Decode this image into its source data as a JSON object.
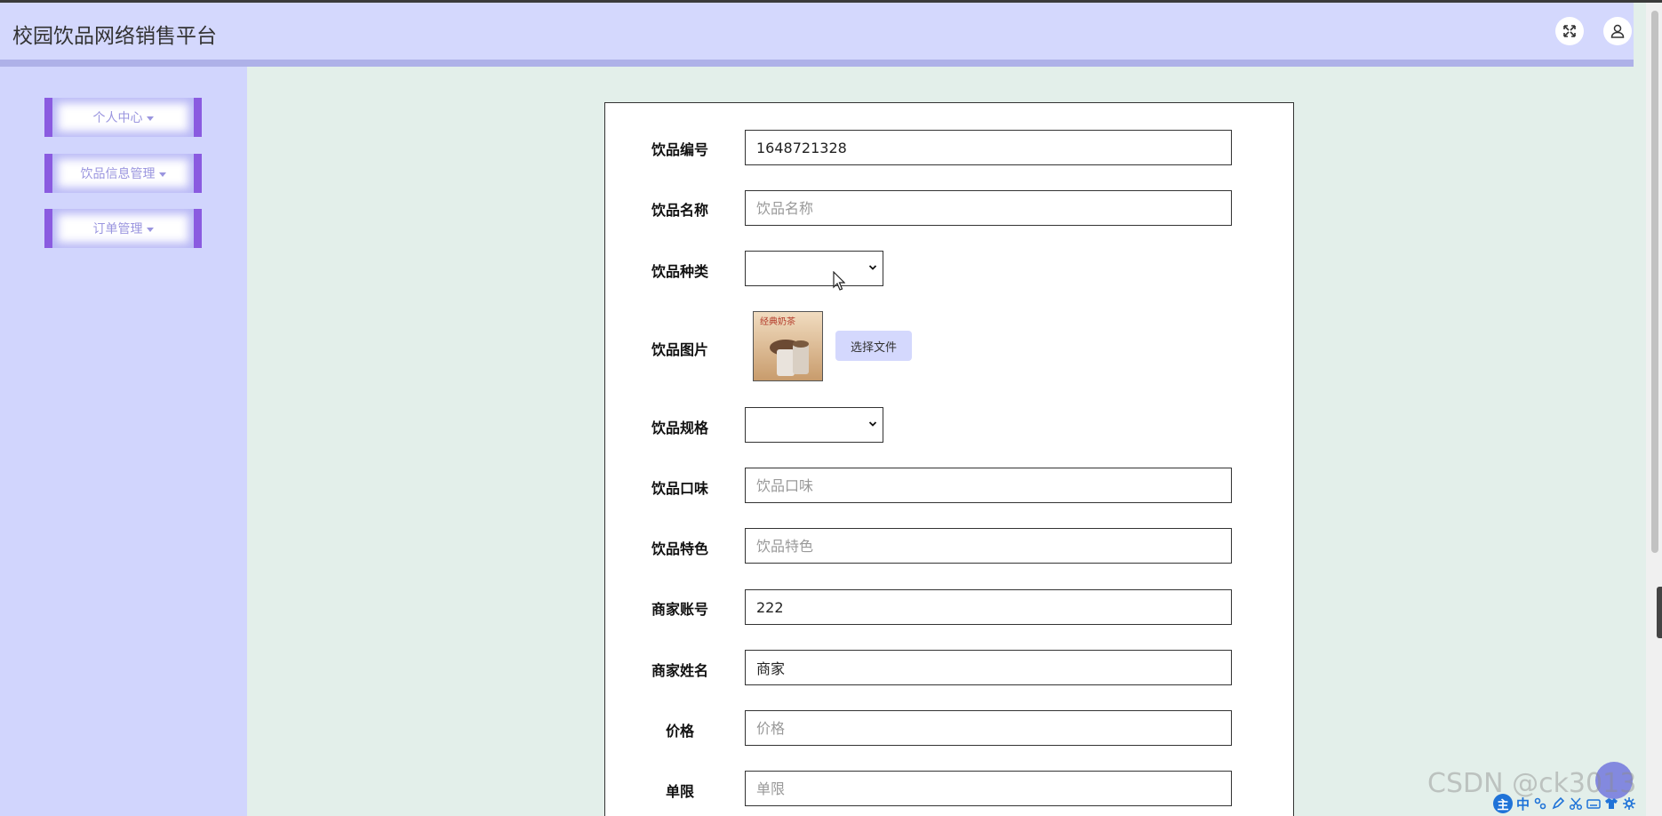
{
  "header": {
    "title": "校园饮品网络销售平台",
    "fullscreen_icon": "expand-arrows-icon",
    "user_icon": "user-icon"
  },
  "sidebar": {
    "items": [
      {
        "label": "个人中心"
      },
      {
        "label": "饮品信息管理"
      },
      {
        "label": "订单管理"
      }
    ]
  },
  "form": {
    "drink_code": {
      "label": "饮品编号",
      "value": "1648721328"
    },
    "drink_name": {
      "label": "饮品名称",
      "placeholder": "饮品名称"
    },
    "drink_type": {
      "label": "饮品种类"
    },
    "drink_image": {
      "label": "饮品图片",
      "thumb_text": "经典奶茶",
      "choose_file": "选择文件"
    },
    "drink_spec": {
      "label": "饮品规格"
    },
    "drink_flavor": {
      "label": "饮品口味",
      "placeholder": "饮品口味"
    },
    "drink_feature": {
      "label": "饮品特色",
      "placeholder": "饮品特色"
    },
    "merchant_account": {
      "label": "商家账号",
      "value": "222"
    },
    "merchant_name": {
      "label": "商家姓名",
      "value": "商家"
    },
    "price": {
      "label": "价格",
      "placeholder": "价格"
    },
    "limit": {
      "label": "单限",
      "placeholder": "单限"
    }
  },
  "overlay": {
    "watermark": "CSDN @ck3013",
    "ime_main": "主",
    "ime_mode": "中"
  },
  "colors": {
    "header_bg": "#d4d8fd",
    "sidebar_bg": "#d1d5fd",
    "content_bg": "#e3efea",
    "menu_border": "#8a5be0"
  }
}
